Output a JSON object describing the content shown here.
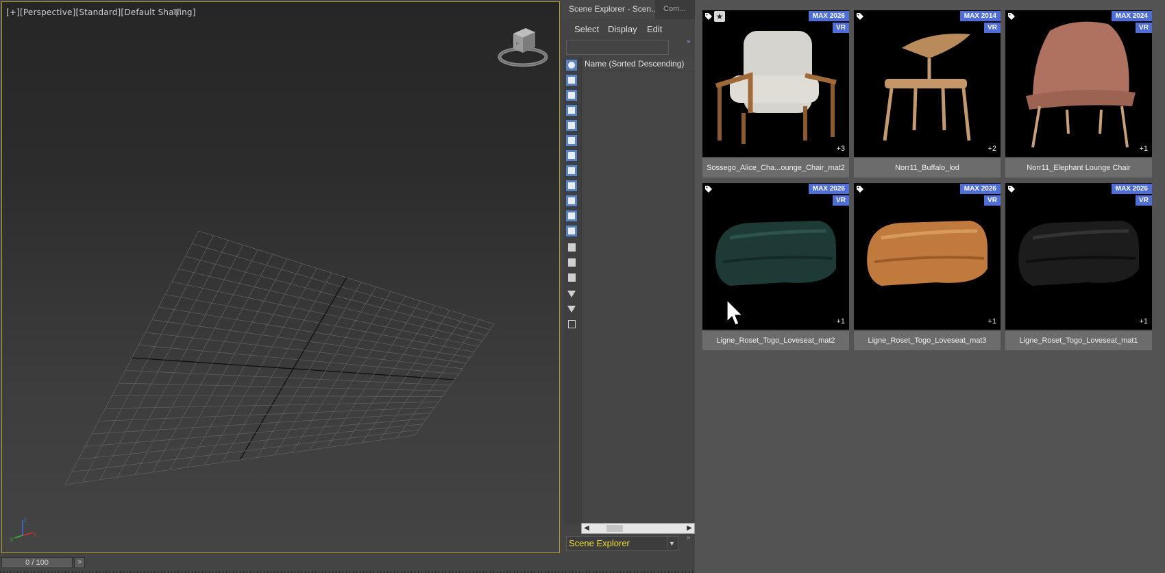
{
  "viewport": {
    "label": "[+][Perspective][Standard][Default Shading]",
    "frame_color": "#b59d2c"
  },
  "timeline": {
    "frame_text": "0 / 100",
    "next_label": ">"
  },
  "scene_explorer": {
    "tabs": [
      "Scene Explorer - Scen...",
      "Com..."
    ],
    "menu": [
      "Select",
      "Display",
      "Edit"
    ],
    "search_value": "",
    "column_header": "Name (Sorted Descending)",
    "footer_dropdown": "Scene Explorer",
    "footer_color": "#f2dd3a",
    "more_label": "»",
    "toolbar_icons": [
      "geometry-filter-icon",
      "shapes-filter-icon",
      "lights-filter-icon",
      "cameras-filter-icon",
      "helpers-filter-icon",
      "spacewarps-filter-icon",
      "groups-filter-icon",
      "xrefs-filter-icon",
      "bones-filter-icon",
      "containers-filter-icon",
      "frozen-filter-icon",
      "hidden-filter-icon",
      "display-all-icon",
      "display-none-icon",
      "invert-display-icon",
      "filter-icon",
      "filter-settings-icon",
      "layer-icon"
    ]
  },
  "browser": {
    "badge_color": "#4f6fd6",
    "cards": [
      {
        "label": "Sossego_Alice_Cha...ounge_Chair_mat2",
        "max": "MAX 2026",
        "vr": "VR",
        "plus": "+3",
        "starred": true
      },
      {
        "label": "Norr11_Buffalo_lod",
        "max": "MAX 2014",
        "vr": "VR",
        "plus": "+2",
        "starred": false
      },
      {
        "label": "Norr11_Elephant Lounge Chair",
        "max": "MAX 2024",
        "vr": "VR",
        "plus": "+1",
        "starred": false
      },
      {
        "label": "Ligne_Roset_Togo_Loveseat_mat2",
        "max": "MAX 2026",
        "vr": "VR",
        "plus": "+1",
        "starred": false
      },
      {
        "label": "Ligne_Roset_Togo_Loveseat_mat3",
        "max": "MAX 2026",
        "vr": "VR",
        "plus": "+1",
        "starred": false
      },
      {
        "label": "Ligne_Roset_Togo_Loveseat_mat1",
        "max": "MAX 2026",
        "vr": "VR",
        "plus": "+1",
        "starred": false
      }
    ]
  }
}
